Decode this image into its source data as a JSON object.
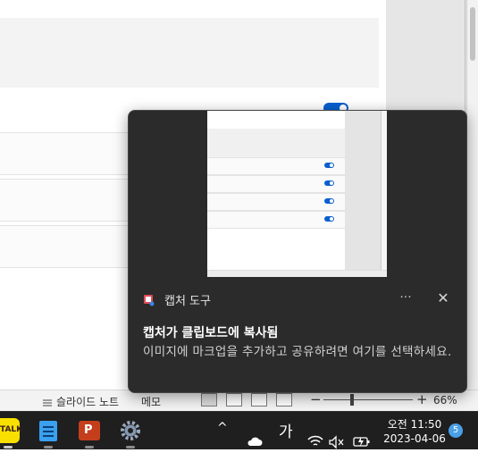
{
  "toast": {
    "app_name": "캡처 도구",
    "more_label": "···",
    "close_label": "✕",
    "title": "캡처가 클립보드에 복사됨",
    "body": "이미지에 마크업을 추가하고 공유하려면 여기를 선택하세요."
  },
  "statusbar": {
    "notes_label": "슬라이드 노트",
    "memo_label": "메모",
    "zoom_minus": "−",
    "zoom_plus": "+",
    "zoom_value": "66%"
  },
  "tray": {
    "chevron": "^",
    "ime": "가",
    "time": "오전 11:50",
    "date": "2023-04-06",
    "notification_count": "5"
  },
  "taskbar": {
    "apps": [
      "kakaotalk",
      "notepad",
      "powerpoint",
      "settings"
    ],
    "kakao_label": "TALK",
    "ppt_label": "P"
  },
  "colors": {
    "toast_bg": "#2b2b2b",
    "accent": "#0a5fcf",
    "taskbar_bg": "#1f1f1f",
    "powerpoint": "#c43e1c",
    "kakao": "#f9e000"
  },
  "icons": [
    "snipping-tool-icon",
    "cloud-icon",
    "wifi-icon",
    "speaker-muted-icon",
    "battery-icon",
    "settings-gear-icon",
    "notes-icon"
  ]
}
